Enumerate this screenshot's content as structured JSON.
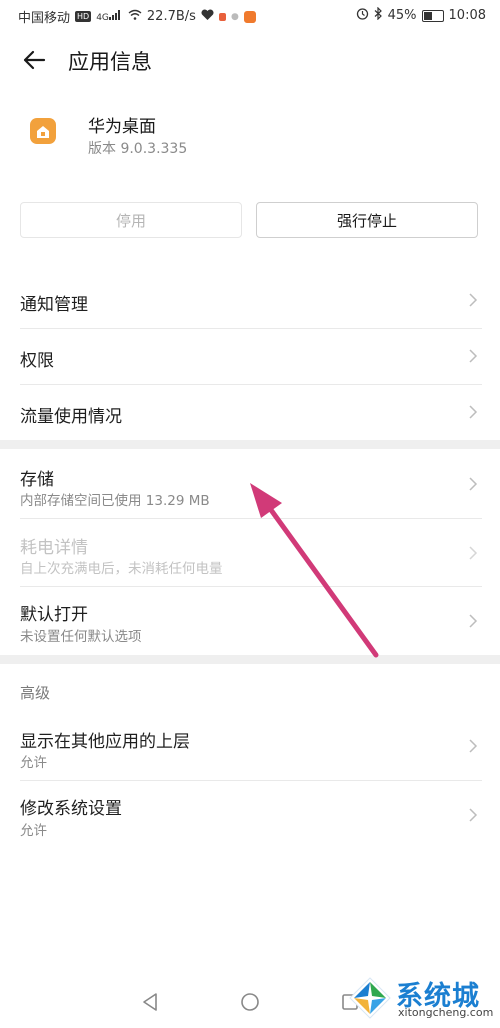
{
  "status_bar": {
    "carrier": "中国移动",
    "hd": "HD",
    "network_type": "4G",
    "speed": "22.7B/s",
    "battery_percent": "45%",
    "battery_level": 0.45,
    "time": "10:08"
  },
  "header": {
    "title": "应用信息"
  },
  "app": {
    "name": "华为桌面",
    "version": "版本 9.0.3.335"
  },
  "actions": {
    "disable_label": "停用",
    "force_stop_label": "强行停止"
  },
  "group1": [
    {
      "label": "通知管理"
    },
    {
      "label": "权限"
    },
    {
      "label": "流量使用情况"
    }
  ],
  "group2": [
    {
      "label": "存储",
      "sub": "内部存储空间已使用 13.29 MB"
    },
    {
      "label": "耗电详情",
      "sub": "自上次充满电后，未消耗任何电量"
    },
    {
      "label": "默认打开",
      "sub": "未设置任何默认选项"
    }
  ],
  "advanced": {
    "header": "高级",
    "items": [
      {
        "label": "显示在其他应用的上层",
        "sub": "允许"
      },
      {
        "label": "修改系统设置",
        "sub": "允许"
      }
    ]
  },
  "watermark": {
    "text": "系统城",
    "url": "xitongcheng.com"
  },
  "colors": {
    "annotation_arrow": "#d13a78",
    "app_icon": "#f2a13c",
    "watermark": "#1b7fd1"
  }
}
